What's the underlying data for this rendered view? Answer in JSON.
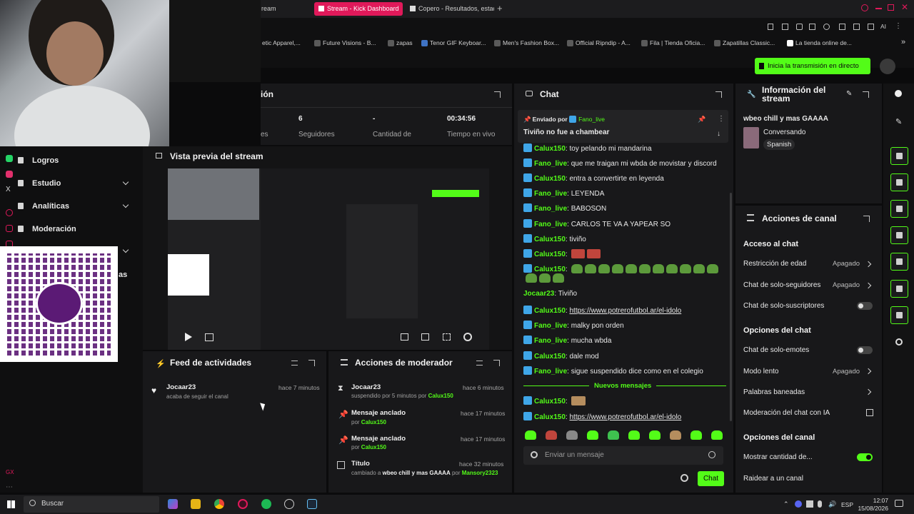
{
  "browser": {
    "tabs": [
      {
        "label": "ream"
      },
      {
        "label": "Stream - Kick Dashboard"
      },
      {
        "label": "Copero - Resultados, estad"
      }
    ],
    "bookmarks": [
      "etic Apparel,...",
      "Future Visions - B...",
      "zapas",
      "Tenor GIF Keyboar...",
      "Men's Fashion Box...",
      "Official Ripndip - A...",
      "Fila | Tienda Oficia...",
      "Zapatillas Classic...",
      "La tienda online de..."
    ]
  },
  "header": {
    "go_live_label": "Inicia la transmisión en directo"
  },
  "sidebar": {
    "items": [
      {
        "label": "Logros"
      },
      {
        "label": "Estudio"
      },
      {
        "label": "Analíticas"
      },
      {
        "label": "Moderación"
      }
    ],
    "partial_label": "as"
  },
  "stats": {
    "title_partial": "ión",
    "followers": {
      "value": "6",
      "label": "Seguidores"
    },
    "amount": {
      "value": "-",
      "label": "Cantidad de"
    },
    "live_time": {
      "value": "00:34:56",
      "label": "Tiempo en vivo"
    },
    "partial_label": "es"
  },
  "preview": {
    "title": "Vista previa del stream"
  },
  "feed": {
    "title": "Feed de actividades",
    "items": [
      {
        "user": "Jocaar23",
        "text": "acaba de seguir el canal",
        "time": "hace 7 minutos"
      }
    ]
  },
  "mod_actions": {
    "title": "Acciones de moderador",
    "items": [
      {
        "title": "Jocaar23",
        "pre": "suspendido por 5 minutos por",
        "user": "Calux150",
        "post": "",
        "time": "hace 6 minutos"
      },
      {
        "title": "Mensaje anclado",
        "pre": "por",
        "user": "Calux150",
        "post": "",
        "time": "hace 17 minutos"
      },
      {
        "title": "Mensaje anclado",
        "pre": "por",
        "user": "Calux150",
        "post": "",
        "time": "hace 17 minutos"
      },
      {
        "title": "Título",
        "pre": "cambiado a",
        "bold": "wbeo chill y mas GAAAA",
        "mid": "por",
        "user": "Mansory2323",
        "time": "hace 32 minutos"
      }
    ]
  },
  "chat": {
    "title": "Chat",
    "pinned": {
      "sent_by": "Enviado por",
      "user": "Fano_live",
      "text": "Tiviño no fue a chambear"
    },
    "messages": [
      {
        "user": "Calux150",
        "text": "toy pelando mi mandarina"
      },
      {
        "user": "Fano_live",
        "text": "que me traigan mi wbda de movistar y discord"
      },
      {
        "user": "Calux150",
        "text": "entra a convertirte en leyenda"
      },
      {
        "user": "Fano_live",
        "text": "LEYENDA"
      },
      {
        "user": "Fano_live",
        "text": "BABOSON"
      },
      {
        "user": "Fano_live",
        "text": "CARLOS TE VA A YAPEAR SO"
      },
      {
        "user": "Calux150",
        "text": "tiviño"
      },
      {
        "user": "Calux150",
        "text": ""
      },
      {
        "user": "Calux150",
        "text": ""
      },
      {
        "user": "Jocaar23",
        "text": "Tiviño"
      },
      {
        "user": "Calux150",
        "text": "https://www.potrerofutbol.ar/el-idolo"
      },
      {
        "user": "Fano_live",
        "text": "malky pon orden"
      },
      {
        "user": "Fano_live",
        "text": "mucha wbda"
      },
      {
        "user": "Calux150",
        "text": "dale mod"
      },
      {
        "user": "Fano_live",
        "text": "sigue suspendido dice como en el colegio"
      }
    ],
    "new_messages_label": "Nuevos mensajes",
    "new_messages": [
      {
        "user": "Calux150",
        "text": ""
      },
      {
        "user": "Calux150",
        "text": "https://www.potrerofutbol.ar/el-idolo"
      }
    ],
    "input_placeholder": "Enviar un mensaje",
    "send_label": "Chat"
  },
  "stream_info": {
    "title": "Información del stream",
    "stream_title": "wbeo chill y mas GAAAA",
    "category": "Conversando",
    "language": "Spanish"
  },
  "channel_actions": {
    "title": "Acciones de canal",
    "chat_access": "Acceso al chat",
    "age_restriction": {
      "label": "Restricción de edad",
      "value": "Apagado"
    },
    "followers_only": {
      "label": "Chat de solo-seguidores",
      "value": "Apagado"
    },
    "subscribers_only": {
      "label": "Chat de solo-suscriptores"
    },
    "chat_options": "Opciones del chat",
    "emotes_only": {
      "label": "Chat de solo-emotes"
    },
    "slow_mode": {
      "label": "Modo lento",
      "value": "Apagado"
    },
    "banned_words": {
      "label": "Palabras baneadas"
    },
    "ai_moderation": {
      "label": "Moderación del chat con IA"
    },
    "channel_options": "Opciones del canal",
    "show_count": {
      "label": "Mostrar cantidad de..."
    },
    "raid": {
      "label": "Raidear a un canal"
    }
  },
  "taskbar": {
    "search_placeholder": "Buscar",
    "lang": "ESP",
    "time": "12:07",
    "date": "15/08/2026"
  }
}
